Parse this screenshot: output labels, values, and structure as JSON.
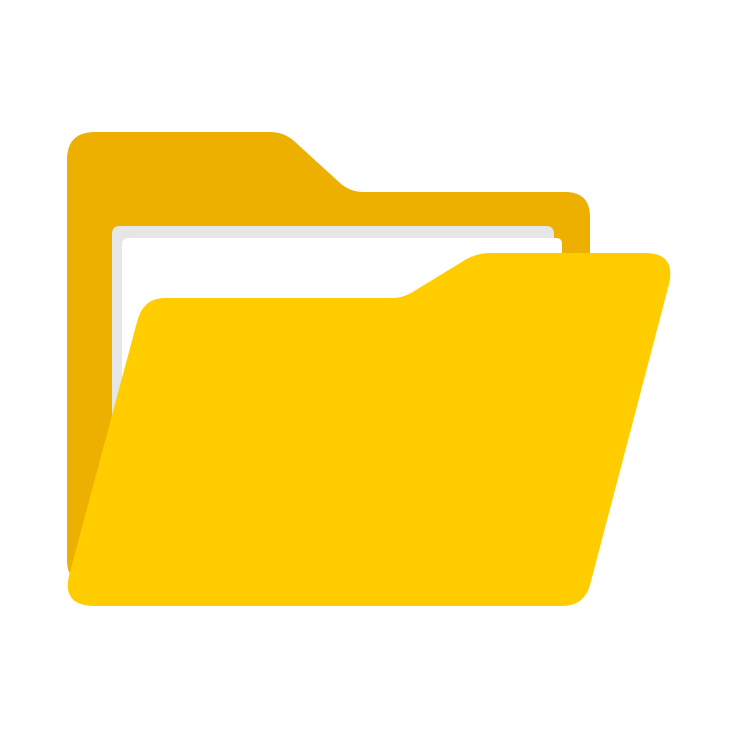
{
  "icon": {
    "name": "open-folder-icon",
    "colors": {
      "back_panel": "#EDB001",
      "paper_shadow": "#E6E6E6",
      "paper": "#FFFFFF",
      "front_panel": "#FFCC00",
      "background": "#FFFFFF"
    }
  }
}
